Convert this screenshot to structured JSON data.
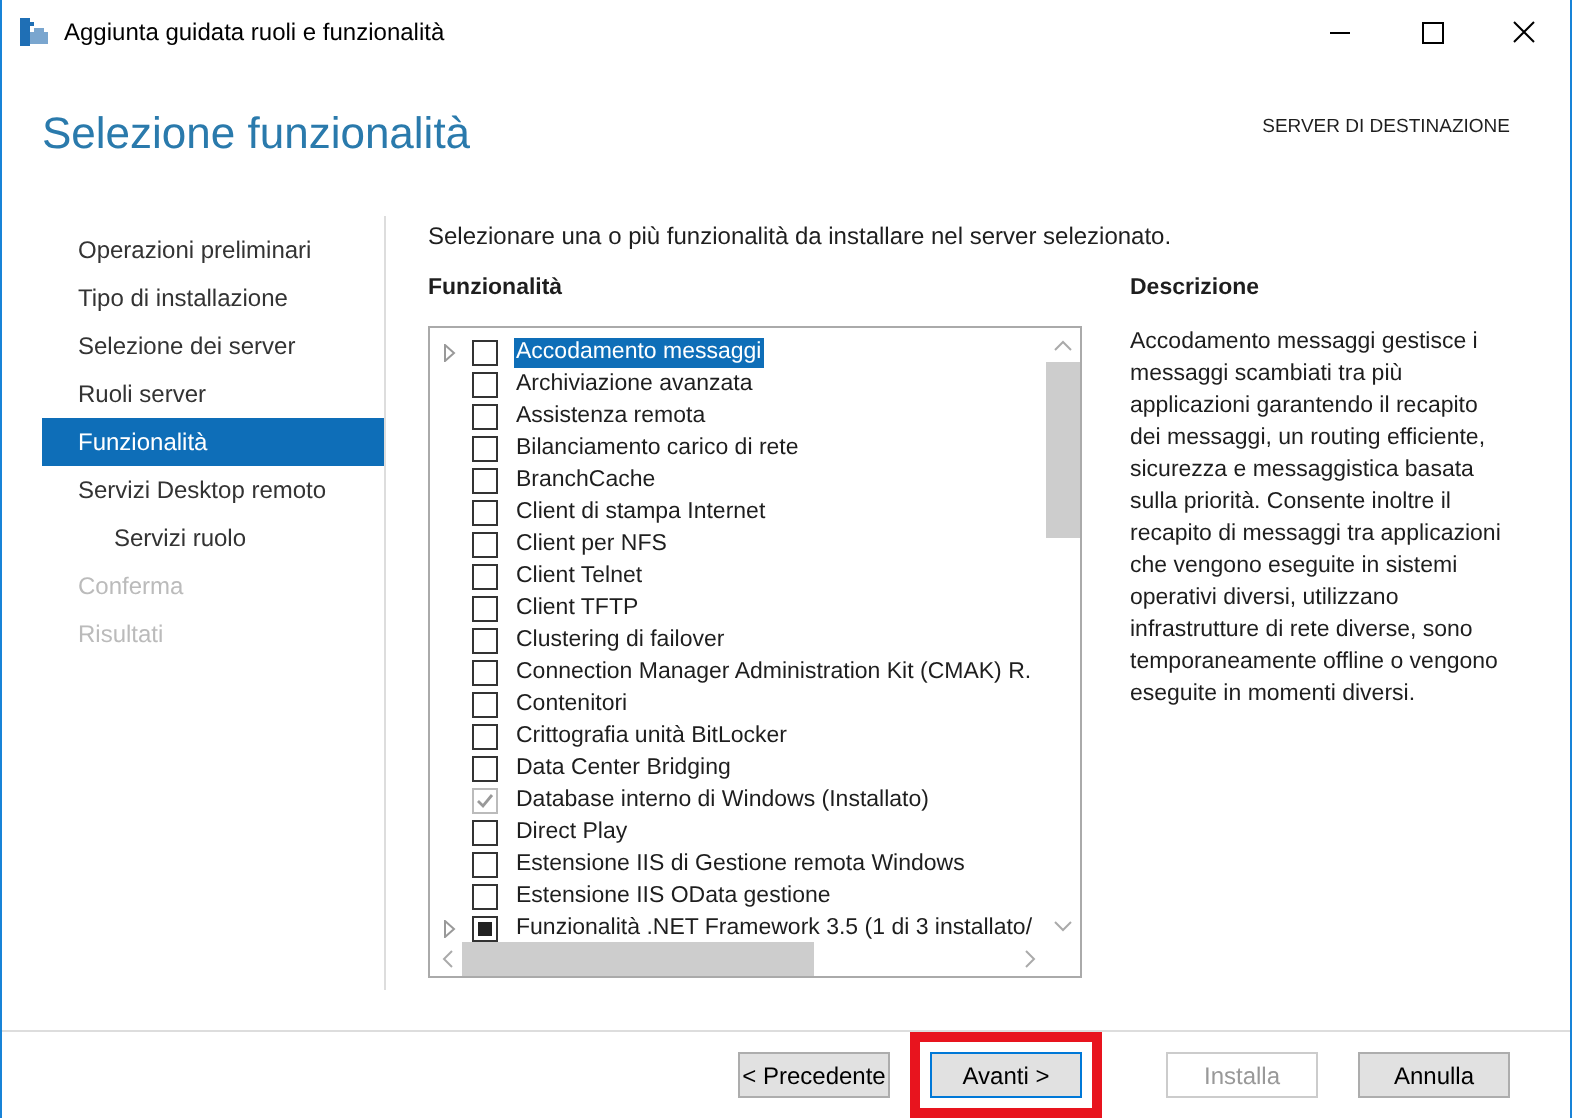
{
  "window": {
    "title": "Aggiunta guidata ruoli e funzionalità"
  },
  "header": {
    "title": "Selezione funzionalità",
    "destination_label": "SERVER DI DESTINAZIONE"
  },
  "sidebar": {
    "items": [
      {
        "label": "Operazioni preliminari",
        "selected": false,
        "disabled": false
      },
      {
        "label": "Tipo di installazione",
        "selected": false,
        "disabled": false
      },
      {
        "label": "Selezione dei server",
        "selected": false,
        "disabled": false
      },
      {
        "label": "Ruoli server",
        "selected": false,
        "disabled": false
      },
      {
        "label": "Funzionalità",
        "selected": true,
        "disabled": false
      },
      {
        "label": "Servizi Desktop remoto",
        "selected": false,
        "disabled": false,
        "children": [
          {
            "label": "Servizi ruolo",
            "selected": false,
            "disabled": false
          }
        ]
      },
      {
        "label": "Conferma",
        "selected": false,
        "disabled": true
      },
      {
        "label": "Risultati",
        "selected": false,
        "disabled": true
      }
    ]
  },
  "instruction": "Selezionare una o più funzionalità da installare nel server selezionato.",
  "features": {
    "heading": "Funzionalità",
    "items": [
      {
        "label": "Accodamento messaggi",
        "expandable": true,
        "checked": false,
        "disabled": false,
        "indeterminate": false,
        "selected": true
      },
      {
        "label": "Archiviazione avanzata",
        "expandable": false,
        "checked": false,
        "disabled": false,
        "indeterminate": false,
        "selected": false
      },
      {
        "label": "Assistenza remota",
        "expandable": false,
        "checked": false,
        "disabled": false,
        "indeterminate": false,
        "selected": false
      },
      {
        "label": "Bilanciamento carico di rete",
        "expandable": false,
        "checked": false,
        "disabled": false,
        "indeterminate": false,
        "selected": false
      },
      {
        "label": "BranchCache",
        "expandable": false,
        "checked": false,
        "disabled": false,
        "indeterminate": false,
        "selected": false
      },
      {
        "label": "Client di stampa Internet",
        "expandable": false,
        "checked": false,
        "disabled": false,
        "indeterminate": false,
        "selected": false
      },
      {
        "label": "Client per NFS",
        "expandable": false,
        "checked": false,
        "disabled": false,
        "indeterminate": false,
        "selected": false
      },
      {
        "label": "Client Telnet",
        "expandable": false,
        "checked": false,
        "disabled": false,
        "indeterminate": false,
        "selected": false
      },
      {
        "label": "Client TFTP",
        "expandable": false,
        "checked": false,
        "disabled": false,
        "indeterminate": false,
        "selected": false
      },
      {
        "label": "Clustering di failover",
        "expandable": false,
        "checked": false,
        "disabled": false,
        "indeterminate": false,
        "selected": false
      },
      {
        "label": "Connection Manager Administration Kit (CMAK) R.",
        "expandable": false,
        "checked": false,
        "disabled": false,
        "indeterminate": false,
        "selected": false
      },
      {
        "label": "Contenitori",
        "expandable": false,
        "checked": false,
        "disabled": false,
        "indeterminate": false,
        "selected": false
      },
      {
        "label": "Crittografia unità BitLocker",
        "expandable": false,
        "checked": false,
        "disabled": false,
        "indeterminate": false,
        "selected": false
      },
      {
        "label": "Data Center Bridging",
        "expandable": false,
        "checked": false,
        "disabled": false,
        "indeterminate": false,
        "selected": false
      },
      {
        "label": "Database interno di Windows (Installato)",
        "expandable": false,
        "checked": true,
        "disabled": true,
        "indeterminate": false,
        "selected": false
      },
      {
        "label": "Direct Play",
        "expandable": false,
        "checked": false,
        "disabled": false,
        "indeterminate": false,
        "selected": false
      },
      {
        "label": "Estensione IIS di Gestione remota Windows",
        "expandable": false,
        "checked": false,
        "disabled": false,
        "indeterminate": false,
        "selected": false
      },
      {
        "label": "Estensione IIS OData gestione",
        "expandable": false,
        "checked": false,
        "disabled": false,
        "indeterminate": false,
        "selected": false
      },
      {
        "label": "Funzionalità .NET Framework 3.5 (1 di 3 installato/",
        "expandable": true,
        "checked": false,
        "disabled": false,
        "indeterminate": true,
        "selected": false
      }
    ]
  },
  "description": {
    "heading": "Descrizione",
    "text": "Accodamento messaggi gestisce i messaggi scambiati tra più applicazioni garantendo il recapito dei messaggi, un routing efficiente, sicurezza e messaggistica basata sulla priorità. Consente inoltre il recapito di messaggi tra applicazioni che vengono eseguite in sistemi operativi diversi, utilizzano infrastrutture di rete diverse, sono temporaneamente offline o vengono eseguite in momenti diversi."
  },
  "buttons": [
    {
      "label": "< Precedente",
      "disabled": false,
      "focused": false
    },
    {
      "label": "Avanti >",
      "disabled": false,
      "focused": true,
      "highlighted": true
    },
    {
      "label": "Installa",
      "disabled": true,
      "focused": false
    },
    {
      "label": "Annulla",
      "disabled": false,
      "focused": false
    }
  ]
}
